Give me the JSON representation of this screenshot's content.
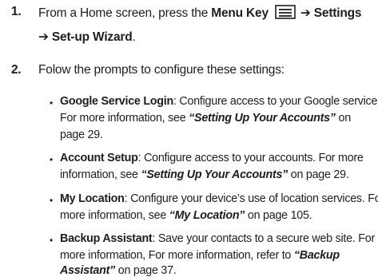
{
  "step1": {
    "number": "1.",
    "line1_prefix": "From a Home screen, press the ",
    "menu_key": "Menu Key",
    "arrow": "➔",
    "settings": "Settings",
    "line2_arrow": "➔",
    "wizard": "Set-up Wizard",
    "period": "."
  },
  "step2": {
    "number": "2.",
    "text": "Folow the prompts to configure these settings:"
  },
  "bullets": [
    {
      "title": "Google Service Login",
      "l1": ": Configure access to your Google service.",
      "l2a": "For more information, see ",
      "l2ref": "“Setting Up Your Accounts”",
      "l2b": " on",
      "l3": "page 29."
    },
    {
      "title": "Account Setup",
      "l1": ": Configure access to your accounts. For more",
      "l2a": "information, see ",
      "l2ref": "“Setting Up Your Accounts”",
      "l2b": " on page 29."
    },
    {
      "title": "My Location",
      "l1": ": Configure your device’s use of location services. For",
      "l2a": "more information, see ",
      "l2ref": "“My Location”",
      "l2b": " on page 105."
    },
    {
      "title": "Backup Assistant",
      "l1": ": Save your contacts to a secure web site. For",
      "l2a": "more information, For more information, refer to ",
      "l2ref": "“Backup",
      "l3ref": "Assistant”",
      "l3b": "  on page 37."
    }
  ]
}
